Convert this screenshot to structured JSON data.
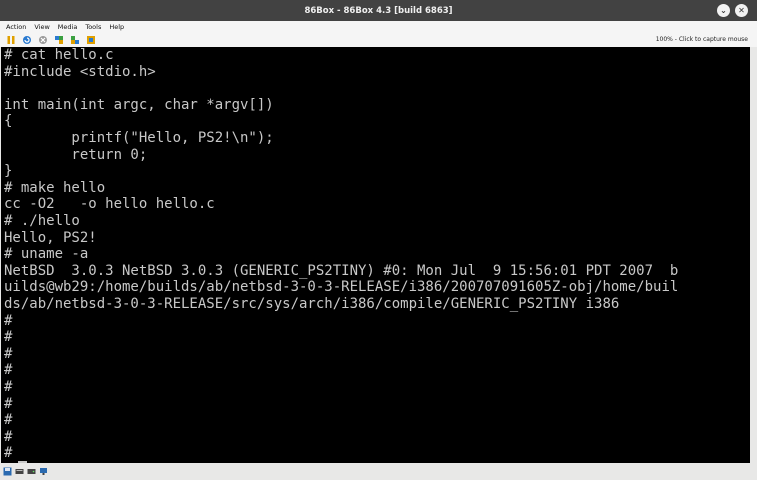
{
  "window": {
    "title": "86Box - 86Box 4.3 [build 6863]",
    "minimize_glyph": "⌄",
    "close_glyph": "✕"
  },
  "menu": [
    "Action",
    "View",
    "Media",
    "Tools",
    "Help"
  ],
  "toolbar": {
    "tools": [
      "pause-icon",
      "ctrl-alt-del-icon",
      "ctrl-alt-esc-icon",
      "hard-reset-icon",
      "acpi-shutdown-icon",
      "settings-icon"
    ],
    "capture_hint": "100% - Click to capture mouse"
  },
  "terminal": {
    "lines": [
      "# cat hello.c",
      "#include <stdio.h>",
      "",
      "int main(int argc, char *argv[])",
      "{",
      "        printf(\"Hello, PS2!\\n\");",
      "        return 0;",
      "}",
      "# make hello",
      "cc -O2   -o hello hello.c",
      "# ./hello",
      "Hello, PS2!",
      "# uname -a",
      "NetBSD  3.0.3 NetBSD 3.0.3 (GENERIC_PS2TINY) #0: Mon Jul  9 15:56:01 PDT 2007  b",
      "uilds@wb29:/home/builds/ab/netbsd-3-0-3-RELEASE/i386/200707091605Z-obj/home/buil",
      "ds/ab/netbsd-3-0-3-RELEASE/src/sys/arch/i386/compile/GENERIC_PS2TINY i386",
      "#",
      "#",
      "#",
      "#",
      "#",
      "#",
      "#",
      "#",
      "#"
    ]
  },
  "statusbar": {
    "icons": [
      "floppy-drive-icon",
      "cdrom-drive-icon",
      "hard-disk-icon",
      "network-icon"
    ]
  },
  "colors": {
    "titlebar": "#424242",
    "screen_bg": "#000000",
    "terminal_text": "#c8c8c8"
  }
}
